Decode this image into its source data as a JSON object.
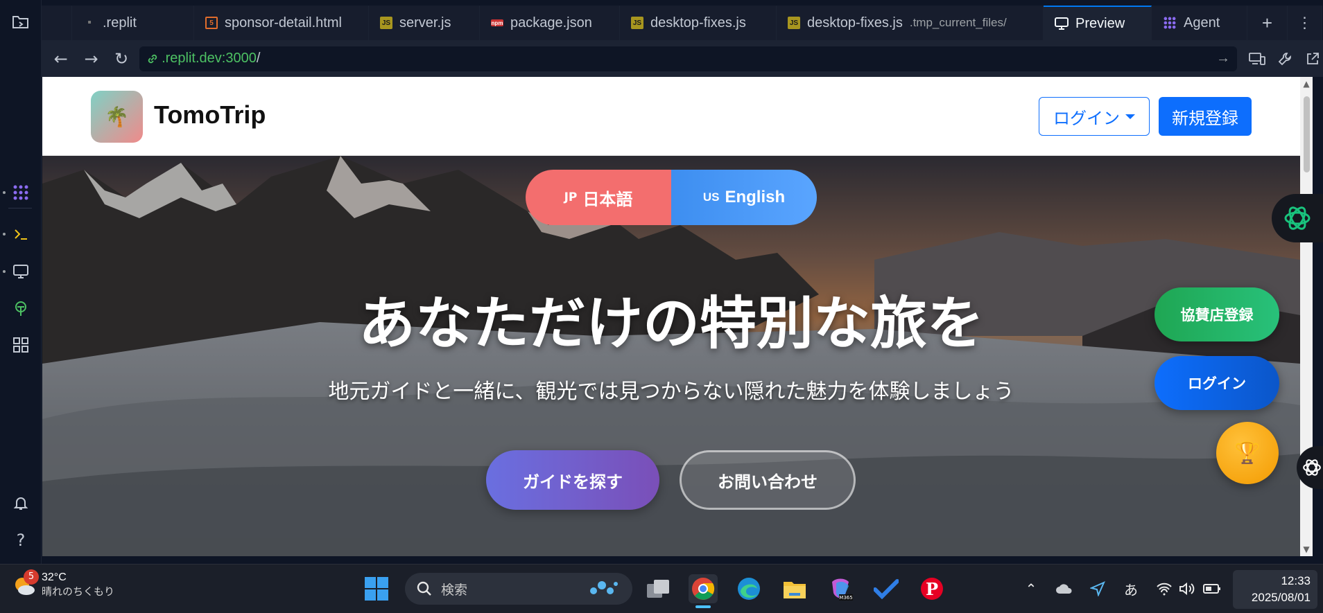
{
  "tabs": [
    {
      "label": ".replit",
      "sub": "",
      "icon": "replit-file-icon"
    },
    {
      "label": "sponsor-detail.html",
      "sub": "",
      "icon": "html-file-icon"
    },
    {
      "label": "server.js",
      "sub": "",
      "icon": "js-file-icon"
    },
    {
      "label": "package.json",
      "sub": "",
      "icon": "npm-file-icon"
    },
    {
      "label": "desktop-fixes.js",
      "sub": "",
      "icon": "js-file-icon"
    },
    {
      "label": "desktop-fixes.js",
      "sub": ".tmp_current_files/",
      "icon": "js-file-icon"
    },
    {
      "label": "Preview",
      "sub": "",
      "icon": "monitor-icon"
    },
    {
      "label": "Agent",
      "sub": "",
      "icon": "agent-icon"
    }
  ],
  "url": {
    "host": ".replit.dev:3000",
    "path": "/"
  },
  "site": {
    "brand": "TomoTrip",
    "logo_emoji": "🌴",
    "login_label": "ログイン",
    "signup_label": "新規登録"
  },
  "hero": {
    "lang_jp_code": "JP",
    "lang_jp_label": "日本語",
    "lang_en_code": "US",
    "lang_en_label": "English",
    "title": "あなただけの特別な旅を",
    "subtitle": "地元ガイドと一緒に、観光では見つからない隠れた魅力を体験しましょう",
    "find_guide_label": "ガイドを探す",
    "contact_label": "お問い合わせ"
  },
  "floating": {
    "sponsor_label": "協賛店登録",
    "login_label": "ログイン",
    "trophy": "🏆"
  },
  "taskbar": {
    "weather_badge": "5",
    "temperature": "32°C",
    "weather_desc": "晴れのちくもり",
    "search_placeholder": "検索",
    "ime": "あ",
    "time": "12:33",
    "date": "2025/08/01"
  },
  "colors": {
    "accent": "#0d6efd",
    "sponsor_green": "#1fa653",
    "lang_jp": "#f36e6e",
    "replit_bg": "#0e1525"
  }
}
